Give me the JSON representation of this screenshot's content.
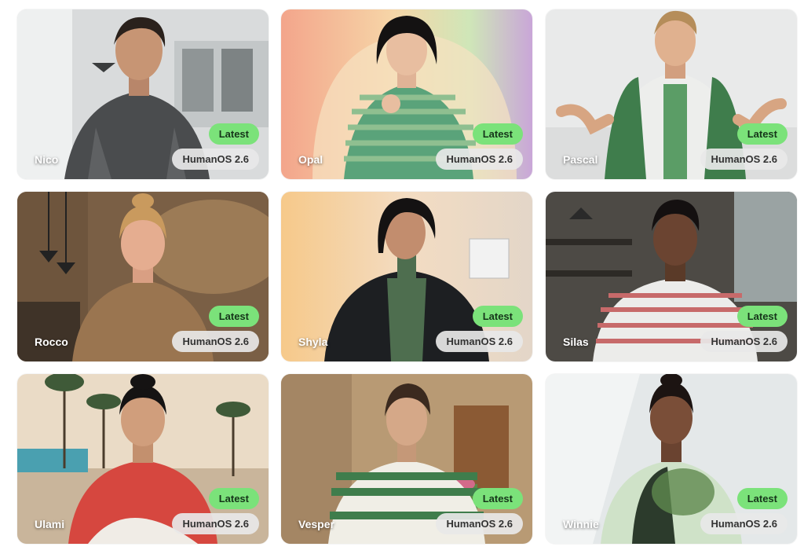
{
  "avatars": [
    {
      "name": "Nico",
      "badge": "Latest",
      "version": "HumanOS 2.6"
    },
    {
      "name": "Opal",
      "badge": "Latest",
      "version": "HumanOS 2.6"
    },
    {
      "name": "Pascal",
      "badge": "Latest",
      "version": "HumanOS 2.6"
    },
    {
      "name": "Rocco",
      "badge": "Latest",
      "version": "HumanOS 2.6"
    },
    {
      "name": "Shyla",
      "badge": "Latest",
      "version": "HumanOS 2.6"
    },
    {
      "name": "Silas",
      "badge": "Latest",
      "version": "HumanOS 2.6"
    },
    {
      "name": "Ulami",
      "badge": "Latest",
      "version": "HumanOS 2.6"
    },
    {
      "name": "Vesper",
      "badge": "Latest",
      "version": "HumanOS 2.6"
    },
    {
      "name": "Winnie",
      "badge": "Latest",
      "version": "HumanOS 2.6"
    }
  ],
  "colors": {
    "latest_badge": "#7be27a",
    "version_badge": "#e8e8e8"
  }
}
